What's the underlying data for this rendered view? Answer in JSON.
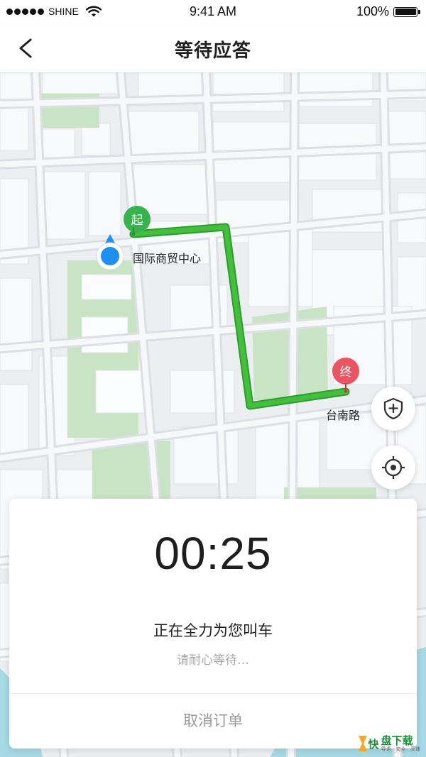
{
  "status_bar": {
    "carrier": "SHINE",
    "time": "9:41 AM",
    "battery": "100%"
  },
  "nav": {
    "title": "等待应答"
  },
  "map": {
    "start_marker": "起",
    "end_marker": "终",
    "start_label": "国际商贸中心",
    "end_label": "台南路",
    "route_color": "#44bf3d",
    "start_color": "#37b24d",
    "end_color": "#e95561",
    "location_color": "#1f8ff0"
  },
  "card": {
    "timer": "00:25",
    "status": "正在全力为您叫车",
    "hint": "请耐心等待…",
    "cancel_label": "取消订单"
  },
  "watermark": {
    "logo_char": "快",
    "name": "盘下载",
    "tagline": "导语 · 安全 · 高速"
  }
}
